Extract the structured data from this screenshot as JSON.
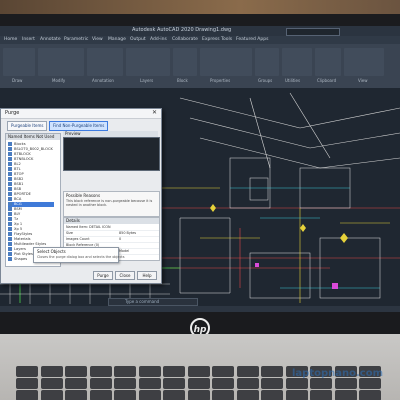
{
  "app": {
    "window_title": "Autodesk AutoCAD 2020  Drawing1.dwg"
  },
  "menu": {
    "items": [
      "Home",
      "Insert",
      "Annotate",
      "Parametric",
      "View",
      "Manage",
      "Output",
      "Add-ins",
      "Collaborate",
      "Express Tools",
      "Featured Apps"
    ]
  },
  "ribbon": {
    "groups": [
      "Draw",
      "Modify",
      "Annotation",
      "Layers",
      "Block",
      "Properties",
      "Groups",
      "Utilities",
      "Clipboard",
      "View"
    ]
  },
  "command_line": {
    "placeholder": "Type a command"
  },
  "dialog": {
    "title": "Purge",
    "close_glyph": "✕",
    "tabs": [
      "Purgeable Items",
      "Find Non-Purgeable Items"
    ],
    "left_panel_title": "Named Items Not Used",
    "tree_items": [
      "Blocks",
      "BSLOT0_B002_BLOCK",
      "BTBLOCK",
      "BTNBLOCK",
      "BL2",
      "BTL",
      "BTOP",
      "BSB2",
      "BSB1",
      "BSB",
      "BPORTDE",
      "BCA",
      "BCG",
      "BSM",
      "BLY",
      "Tz",
      "Xp 1",
      "Xp 5",
      "FlayStyles",
      "Materials",
      "Multileader Styles",
      "Layers",
      "Plot Styles",
      "Shapes"
    ],
    "selected_index": 12,
    "preview_title": "Preview",
    "reasons_title": "Possible Reasons",
    "reasons_text": "This block reference is non-purgeable because it is nested in another block.",
    "details_title": "Details",
    "details": [
      {
        "key": "Named Item: DETAIL ICON",
        "value": ""
      },
      {
        "key": "Size",
        "value": "850 Bytes"
      },
      {
        "key": "Images Count",
        "value": "0"
      },
      {
        "key": "Block Reference (0)",
        "value": ""
      },
      {
        "key": "In layer Arch DIM",
        "value": "Model"
      }
    ],
    "tooltip_title": "Select Objects",
    "tooltip_text": "Closes the purge dialog box and selects the objects",
    "buttons": [
      "Purge",
      "Close",
      "Help"
    ]
  },
  "brand": {
    "logo_text": "hp"
  },
  "watermark": {
    "text": "laptopnano.com"
  },
  "colors": {
    "cad_background": "#1f2731",
    "accent_blue": "#3f7ad8"
  }
}
